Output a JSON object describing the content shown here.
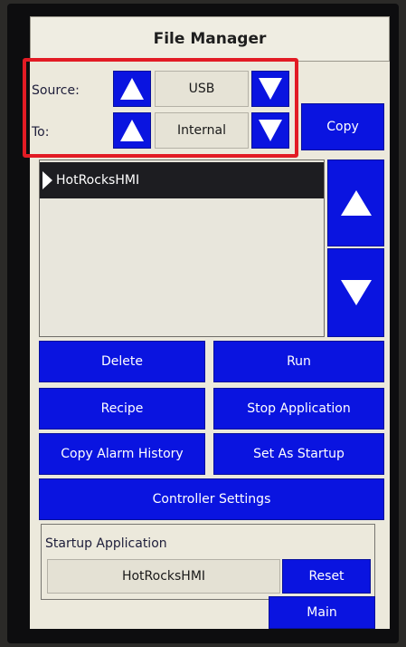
{
  "window": {
    "title": "File Manager"
  },
  "source": {
    "label": "Source:",
    "value": "USB"
  },
  "destination": {
    "label": "To:",
    "value": "Internal"
  },
  "actions": {
    "copy": "Copy",
    "delete": "Delete",
    "run": "Run",
    "recipe": "Recipe",
    "stop_application": "Stop Application",
    "copy_alarm_history": "Copy Alarm History",
    "set_as_startup": "Set As Startup",
    "controller_settings": "Controller Settings"
  },
  "file_list": {
    "items": [
      "HotRocksHMI"
    ],
    "selected": "HotRocksHMI"
  },
  "startup": {
    "label": "Startup Application",
    "value": "HotRocksHMI",
    "reset": "Reset"
  },
  "nav": {
    "main": "Main"
  },
  "colors": {
    "button_blue": "#0a14e0",
    "highlight_red": "#e21b24",
    "panel": "#ece9dc"
  }
}
